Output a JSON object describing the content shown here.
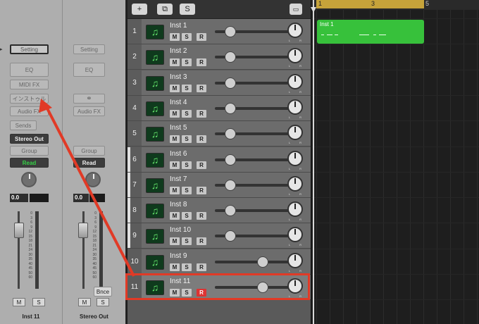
{
  "mixer": {
    "strip1": {
      "setting": "Setting",
      "eq": "EQ",
      "midi_fx": "MIDI FX",
      "instrument": "インストゥル",
      "audio_fx": "Audio FX",
      "sends": "Sends",
      "output": "Stereo Out",
      "group": "Group",
      "automation": "Read",
      "value": "0.0",
      "mute": "M",
      "solo": "S",
      "name": "Inst 11"
    },
    "strip2": {
      "setting": "Setting",
      "eq": "EQ",
      "audio_fx": "Audio FX",
      "group": "Group",
      "automation": "Read",
      "value": "0.0",
      "bounce": "Bnce",
      "mute": "M",
      "solo": "S",
      "name": "Stereo Out"
    },
    "scale": [
      "0",
      "3",
      "6",
      "9",
      "12",
      "15",
      "18",
      "21",
      "24",
      "30",
      "35",
      "40",
      "45",
      "50",
      "60"
    ]
  },
  "track_header": {
    "add_label": "+",
    "solo_label": "S"
  },
  "tracks": [
    {
      "num": "1",
      "name": "Inst 1",
      "mute": "M",
      "solo": "S",
      "rec": "R",
      "volume": 0.2,
      "selected": false
    },
    {
      "num": "2",
      "name": "Inst 2",
      "mute": "M",
      "solo": "S",
      "rec": "R",
      "volume": 0.2,
      "selected": false
    },
    {
      "num": "3",
      "name": "Inst 3",
      "mute": "M",
      "solo": "S",
      "rec": "R",
      "volume": 0.2,
      "selected": false
    },
    {
      "num": "4",
      "name": "Inst 4",
      "mute": "M",
      "solo": "S",
      "rec": "R",
      "volume": 0.2,
      "selected": false
    },
    {
      "num": "5",
      "name": "Inst 5",
      "mute": "M",
      "solo": "S",
      "rec": "R",
      "volume": 0.2,
      "selected": false
    },
    {
      "num": "6",
      "name": "Inst 6",
      "mute": "M",
      "solo": "S",
      "rec": "R",
      "volume": 0.2,
      "selected": false
    },
    {
      "num": "7",
      "name": "Inst 7",
      "mute": "M",
      "solo": "S",
      "rec": "R",
      "volume": 0.2,
      "selected": false
    },
    {
      "num": "8",
      "name": "Inst 8",
      "mute": "M",
      "solo": "S",
      "rec": "R",
      "volume": 0.2,
      "selected": false
    },
    {
      "num": "9",
      "name": "Inst 10",
      "mute": "M",
      "solo": "S",
      "rec": "R",
      "volume": 0.2,
      "selected": false
    },
    {
      "num": "10",
      "name": "Inst 9",
      "mute": "M",
      "solo": "S",
      "rec": "R",
      "volume": 0.62,
      "selected": false
    },
    {
      "num": "11",
      "name": "Inst 11",
      "mute": "M",
      "solo": "S",
      "rec": "R",
      "volume": 0.62,
      "selected": true
    }
  ],
  "pan_labels": {
    "left": "L",
    "right": "R"
  },
  "ruler": {
    "marks": [
      "1",
      "3",
      "5"
    ]
  },
  "region": {
    "name": "Inst 1"
  },
  "colors": {
    "highlight": "#e13a26",
    "region": "#37c13b",
    "cycle": "#c6a33a"
  }
}
